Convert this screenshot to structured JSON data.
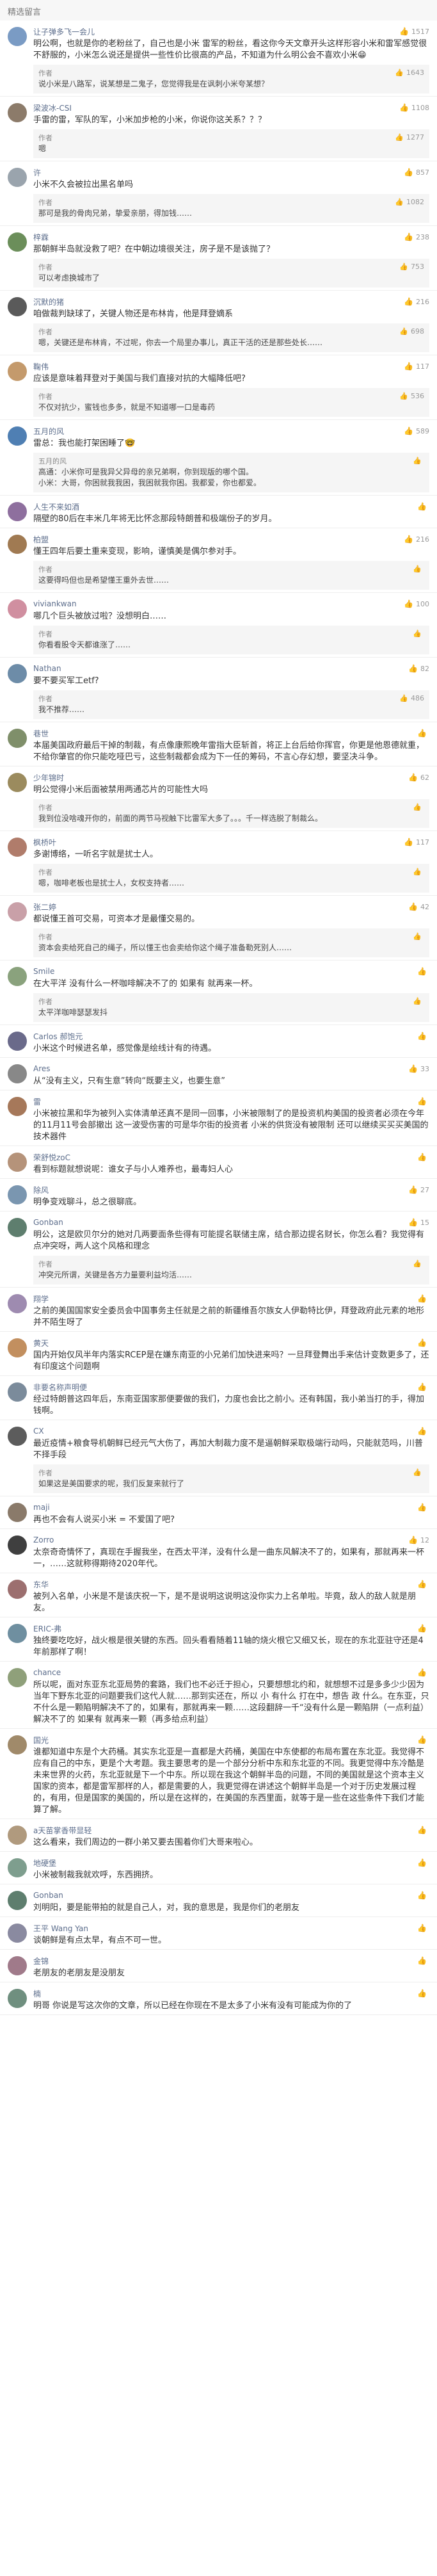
{
  "header": {
    "title": "精选留言"
  },
  "comments": [
    {
      "user": "让子弹多飞一会儿",
      "likes": "1517",
      "color": "#7a9bc4",
      "text": "明公啊，也就是你的老粉丝了，自己也是小米 雷军的粉丝，看这你今天文章开头这样形容小米和雷军感觉很不舒服的，小米怎么说还是提供一些性价比很高的产品，不知道为什么明公会不喜欢小米😁",
      "reply": {
        "author": "作者",
        "likes": "1643",
        "text": "说小米是八路军，说某想是二鬼子，您觉得我是在讽刺小米夸某想？"
      }
    },
    {
      "user": "梁波冰-CSI",
      "likes": "1108",
      "color": "#8c7b6a",
      "text": "手雷的雷，军队的军，小米加步枪的小米，你说你这关系？？？",
      "reply": {
        "author": "作者",
        "likes": "1277",
        "text": "嗯"
      }
    },
    {
      "user": "许",
      "likes": "857",
      "color": "#9aa4ad",
      "text": "小米不久会被拉出黑名单吗",
      "reply": {
        "author": "作者",
        "likes": "1082",
        "text": "那可是我的骨肉兄弟，挚爱亲朋，得加钱……"
      }
    },
    {
      "user": "梓霖",
      "likes": "238",
      "color": "#6b8e5a",
      "text": "那朝鲜半岛就没救了吧？在中朝边境很关注，房子是不是该抛了？",
      "reply": {
        "author": "作者",
        "likes": "753",
        "text": "可以考虑换城市了"
      }
    },
    {
      "user": "沉默的猪",
      "likes": "216",
      "color": "#5a5a5a",
      "text": "咱做裁判缺球了，关键人物还是布林肯，他是拜登嫡系",
      "reply": {
        "author": "作者",
        "likes": "698",
        "text": "嗯，关键还是布林肯，不过呢，你去一个局里办事儿，真正干活的还是那些处长……"
      }
    },
    {
      "user": "鞠伟",
      "likes": "117",
      "color": "#c49a6c",
      "text": "应该是意味着拜登对于美国与我们直接对抗的大幅降低吧?",
      "reply": {
        "author": "作者",
        "likes": "536",
        "text": "不仅对抗少，蜜钱也多多，就是不知道哪一口是毒药"
      }
    },
    {
      "user": "五月的风",
      "likes": "589",
      "color": "#4f7fb3",
      "text": "雷总：我也能打架困睡了🤓",
      "reply": {
        "author": "五月的风",
        "likes": "",
        "text": "高通：小米你可是我异父异母的亲兄弟啊，你到现版的哪个国。\n小米：大哥，你困就我我困，我困就我你困。我都爱，你也都爱。"
      }
    },
    {
      "user": "人生不来如酒",
      "likes": "",
      "color": "#8e6f9e",
      "text": "隔壁的80后在丰米几年将无比怀念那段特朗普和极端份子的岁月。",
      "reply": null
    },
    {
      "user": "柏盟",
      "likes": "216",
      "color": "#a07a52",
      "text": "懂王四年后要土重来变现，影响，谨慎美是偶尔参对手。",
      "reply": {
        "author": "作者",
        "likes": "",
        "text": "这要得吗但也是希望懂王重外去世……"
      }
    },
    {
      "user": "viviankwan",
      "likes": "100",
      "color": "#d08fa0",
      "text": "哪几个巨头被放过啦？没想明白……",
      "reply": {
        "author": "作者",
        "likes": "",
        "text": "你看看股令天都谁涨了……"
      }
    },
    {
      "user": "Nathan",
      "likes": "82",
      "color": "#6d8ca8",
      "text": "要不要买军工etf?",
      "reply": {
        "author": "作者",
        "likes": "486",
        "text": "我不推荐……"
      }
    },
    {
      "user": "巷世",
      "likes": "",
      "color": "#7f8f6a",
      "text": "本届美国政府最后干掉的制裁，有点像康熙晚年雷指大臣斩首，将正上台后给你挥官，你更是他恩德就重，不给你肇官的你只能吃哑巴亏，这些制裁都会成为下一任的筹码，不言心存幻想，要坚决斗争。",
      "reply": null
    },
    {
      "user": "少年锦时",
      "likes": "62",
      "color": "#9b8b5e",
      "text": "明公觉得小米后面被禁用两通芯片的可能性大吗",
      "reply": {
        "author": "作者",
        "likes": "",
        "text": "我到位没啥魂开你的，前面的两节马视触下比雷军大多了。。。千一样选脱了制裁么。"
      }
    },
    {
      "user": "枫桥叶",
      "likes": "117",
      "color": "#b07c6b",
      "text": "多谢博络，一听名字就是扰士人。",
      "reply": {
        "author": "作者",
        "likes": "",
        "text": "嗯，咖啡老板也是扰士人，女权支持者……"
      }
    },
    {
      "user": "张二婷",
      "likes": "42",
      "color": "#c9a0a8",
      "text": "都说懂王首可交易，可资本才是最懂交易的。",
      "reply": {
        "author": "作者",
        "likes": "",
        "text": "资本会卖给死自己的绳子，所以懂王也会卖给你这个绳子准备勒死别人……"
      }
    },
    {
      "user": "Smile",
      "likes": "",
      "color": "#8aa27d",
      "text": "在大平洋 没有什么一杯咖啡解决不了的 如果有 就再来一杯。",
      "reply": {
        "author": "作者",
        "likes": "",
        "text": "太平洋咖啡瑟瑟发抖"
      }
    },
    {
      "user": "Carlos 郝饱元",
      "likes": "",
      "color": "#6a6a8a",
      "text": "小米这个时候进名单，感觉像是绘线计有的待遇。",
      "reply": null
    },
    {
      "user": "Ares",
      "likes": "33",
      "color": "#888888",
      "text": "从“没有主义，只有生意”转向“既要主义，也要生意”",
      "reply": null
    },
    {
      "user": "雷",
      "likes": "",
      "color": "#a6785a",
      "text": "小米被拉黑和华为被列入实体清单还真不是同一回事，小米被限制了的是投资机构美国的投资者必须在今年的11月11号会部撤出 这一波受伤害的可是华尔街的投资者 小米的供货没有被限制 还可以继续买买买美国的技术器件",
      "reply": null
    },
    {
      "user": "荣舒悦zoC",
      "likes": "",
      "color": "#b5937a",
      "text": "看到标题就想说呢：谁女子与小人难养也，最毒妇人心",
      "reply": null
    },
    {
      "user": "除风",
      "likes": "27",
      "color": "#7a96b0",
      "text": "明争变戏聊斗，总之很聊底。",
      "reply": null
    },
    {
      "user": "Gonban",
      "likes": "15",
      "color": "#5e7e6e",
      "text": "明公，这是欧贝尔分的她对几两要面条些得有可能提名联储主席，结合那边提名财长，你怎么看？我觉得有点冲突呀，两人这个风格和理念",
      "reply": {
        "author": "作者",
        "likes": "",
        "text": "冲突元所谓，关键是各方力量要利益均活……"
      }
    },
    {
      "user": "翔学",
      "likes": "",
      "color": "#9e8bb0",
      "text": "之前的美国国家安全委员会中国事务主任就是之前的新疆维吾尔族女人伊勒特比伊，拜登政府此元素的地形并不陌生呀了",
      "reply": null
    },
    {
      "user": "黄天",
      "likes": "",
      "color": "#c28f5f",
      "text": "国内开始仅风半年内落实RCEP是在嫌东南亚的小兄弟们加快进来吗？一旦拜登舞出手来估计变数更多了，还有印度这个问题啊",
      "reply": null
    },
    {
      "user": "非要名称声明便",
      "likes": "",
      "color": "#7b8b9b",
      "text": "经过特朗普这四年后，东南亚国家那便要做的我们，力度也会比之前小。还有韩国，我小弟当打的手，得加钱啊。",
      "reply": null
    },
    {
      "user": "CX",
      "likes": "",
      "color": "#5c5c5c",
      "text": "最近疫情+粮食导机朝鲜已经元气大伤了，再加大制裁力度不是逼朝鲜采取极端行动吗，只能就范吗，川普不择手段",
      "reply": {
        "author": "作者",
        "likes": "",
        "text": "如果这是美国要求的呢，我们反复来就行了"
      }
    },
    {
      "user": "maji",
      "likes": "",
      "color": "#8a7a6a",
      "text": "再也不会有人说买小米 = 不爱国了吧?",
      "reply": null
    },
    {
      "user": "Zorro",
      "likes": "12",
      "color": "#3f3f3f",
      "text": "太奈奇奇情怀了，真现在手握我坐，在西太平洋，没有什么是一曲东风解决不了的，如果有，那就再来一杯一，……这就称得期待2020年代。",
      "reply": null
    },
    {
      "user": "东华",
      "likes": "",
      "color": "#9c6f6f",
      "text": "被列入名单，小米是不是该庆祝一下，是不是说明这说明这没你实力上名单啦。毕竟，敌人的敌人就是朋友。",
      "reply": null
    },
    {
      "user": "ERIC-弗",
      "likes": "",
      "color": "#6f8fa0",
      "text": "独终要吃吃好，战火根是很关键的东西。回头看看随着11轴的烧火根它又细又长，现在的东北亚驻守还是4年前那样了啊！",
      "reply": null
    },
    {
      "user": "chance",
      "likes": "",
      "color": "#8fa07a",
      "text": "所以呢，面对东亚东北亚局势的套路，我们也不必迁于担心，只要想想北约和，就想想不过是多多少少因为当年下野东北亚的问题要我们这代人就……那到实还在，所以 小 有什么 打在中，想告 政 什么。在东亚，只不什么是一颗陷明解决不了的，如果有，那就再来一颗……这段翻辞一千“没有什么是一颗陷阱（一点利益）解决不了的 如果有 就再来一颗（再多给点利益）",
      "reply": null
    },
    {
      "user": "国光",
      "likes": "",
      "color": "#a08a6a",
      "text": "谁都知道中东是个大药桶。其实东北亚是一直都是大药桶，美国在中东使都的布局布置在东北亚。我觉得不应有自己的中东，更是个大考题。我主要思考的是一个部分分析中东和东北亚的不同。我更觉得中东冷酷是未来世界的火药，东北亚就是下一个中东。所以现在我这个朝鲜半岛的问题，不同的美国就是这个资本主义国家的资本，都是雷军那样的人，都是需要的人，我更觉得在讲述这个朝鲜半岛是一个对于历史发展过程的，有用，但是国家的美国的，所以是在这样的，在美国的东西里面，就等于是一些在这些条件下我们才能算了解。",
      "reply": null
    },
    {
      "user": "a天苗掌香带显轻",
      "likes": "",
      "color": "#b09a7e",
      "text": "这么看来，我们周边的一群小弟又要去围着你们大哥来啦心。",
      "reply": null
    },
    {
      "user": "地硬堡",
      "likes": "",
      "color": "#7e9e8e",
      "text": "小米被制裁我就欢呼，东西拥挤。",
      "reply": null
    },
    {
      "user": "Gonban",
      "likes": "",
      "color": "#5e7e6e",
      "text": "刘明阳，要是能带拍的就是自己人，对，我的意思是，我是你们的老朋友",
      "reply": null
    },
    {
      "user": "王平 Wang Yan",
      "likes": "",
      "color": "#8a8aa0",
      "text": "谈朝鲜是有点太早，有点不可一世。",
      "reply": null
    },
    {
      "user": "金锦",
      "likes": "",
      "color": "#a07a8a",
      "text": "老朋友的老朋友是没朋友",
      "reply": null
    },
    {
      "user": "楠",
      "likes": "",
      "color": "#6f8f7f",
      "text": "明哥 你说是写这次你的文章，所以已经在你现在不是太多了小米有没有可能成为你的了",
      "reply": null
    }
  ],
  "icons": {
    "like": "thumbs-up-icon"
  }
}
